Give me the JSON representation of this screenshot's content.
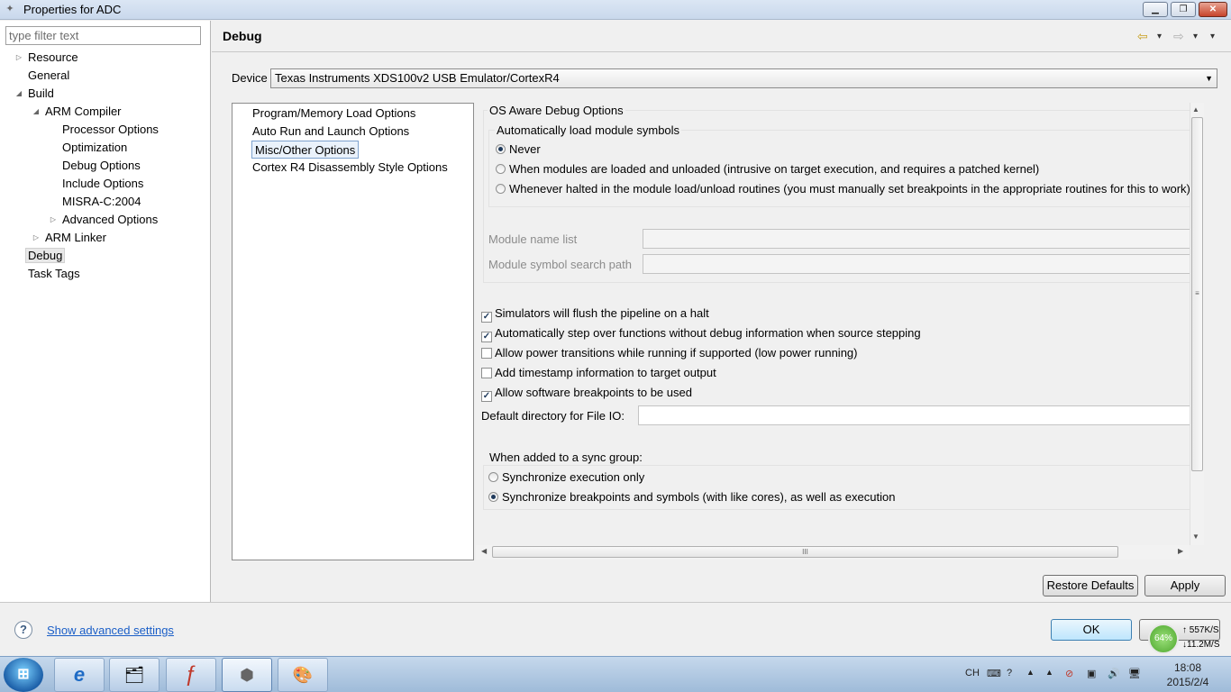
{
  "window": {
    "title": "Properties for ADC",
    "minimize": "▁",
    "maximize": "❐",
    "close": "✕"
  },
  "filter": {
    "placeholder": "type filter text"
  },
  "tree": [
    {
      "label": "Resource",
      "twisty": "▷"
    },
    {
      "label": "General",
      "twisty": ""
    },
    {
      "label": "Build",
      "twisty": "◢"
    },
    {
      "label": "ARM Compiler",
      "twisty": "◢"
    },
    {
      "label": "Processor Options",
      "twisty": ""
    },
    {
      "label": "Optimization",
      "twisty": ""
    },
    {
      "label": "Debug Options",
      "twisty": ""
    },
    {
      "label": "Include Options",
      "twisty": ""
    },
    {
      "label": "MISRA-C:2004",
      "twisty": ""
    },
    {
      "label": "Advanced Options",
      "twisty": "▷"
    },
    {
      "label": "ARM Linker",
      "twisty": "▷"
    },
    {
      "label": "Debug",
      "twisty": ""
    },
    {
      "label": "Task Tags",
      "twisty": ""
    }
  ],
  "main": {
    "title": "Debug",
    "back_icon": "⇦",
    "forward_icon": "⇨",
    "menu_arrow": "▾",
    "device_label": "Device",
    "device_value": "Texas Instruments XDS100v2 USB Emulator/CortexR4",
    "device_arrow": "▼"
  },
  "categories": [
    "Program/Memory Load Options",
    "Auto Run and Launch Options",
    "Misc/Other Options",
    "Cortex R4 Disassembly Style Options"
  ],
  "os_aware": {
    "title": "OS Aware Debug Options",
    "subtitle": "Automatically load module symbols",
    "radios": [
      "Never",
      "When modules are loaded and unloaded (intrusive on target execution, and requires a patched kernel)",
      "Whenever halted in the module load/unload routines (you must manually set breakpoints in the appropriate routines for this to work)"
    ],
    "selected": 0,
    "module_name_label": "Module name list",
    "module_symbol_label": "Module symbol search path"
  },
  "checks": [
    {
      "label": "Simulators will flush the pipeline on a halt",
      "checked": true
    },
    {
      "label": "Automatically step over functions without debug information when source stepping",
      "checked": true
    },
    {
      "label": "Allow power transitions while running if supported (low power running)",
      "checked": false
    },
    {
      "label": "Add timestamp information to target output",
      "checked": false
    },
    {
      "label": "Allow software breakpoints to be used",
      "checked": true
    }
  ],
  "check_mark": "✓",
  "file_io_label": "Default directory for File IO:",
  "sync": {
    "title": "When added to a sync group:",
    "radios": [
      "Synchronize execution only",
      "Synchronize breakpoints and symbols (with like cores), as well as execution"
    ],
    "selected": 1
  },
  "scroll": {
    "up": "▲",
    "down": "▼",
    "left": "◀",
    "right": "▶",
    "grip_v": "≡",
    "grip_h": "III"
  },
  "buttons": {
    "restore": "Restore Defaults",
    "apply": "Apply",
    "ok": "OK"
  },
  "footer": {
    "help": "?",
    "advanced_link": "Show advanced settings"
  },
  "netmon": {
    "percent": "64%",
    "upload": "↑ 557K/S",
    "download": "↓11.2M/S"
  },
  "taskbar": {
    "start": "⊞",
    "tasks": [
      "e",
      "🗂",
      "ƒ",
      "⬢",
      "🎨"
    ],
    "ime": "CH",
    "tray_icons": [
      "⌨",
      "?",
      "▲",
      "⊘",
      "▣",
      "🔊",
      "🖥"
    ],
    "time": "18:08",
    "date": "2015/2/4"
  }
}
